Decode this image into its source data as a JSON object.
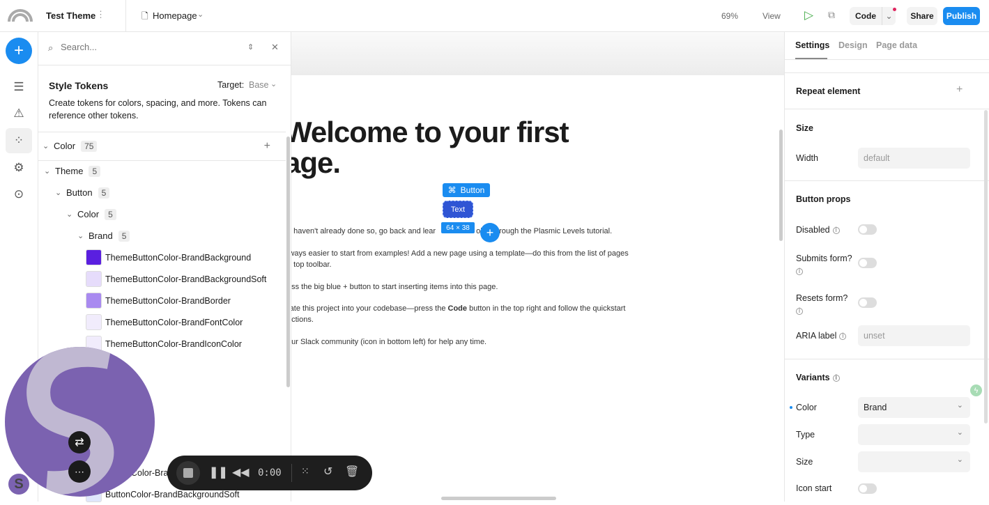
{
  "topbar": {
    "project": "Test Theme",
    "page": "Homepage",
    "zoom": "69%",
    "view": "View",
    "code": "Code",
    "share": "Share",
    "publish": "Publish"
  },
  "left_panel": {
    "search_placeholder": "Search...",
    "title": "Style Tokens",
    "target_label": "Target:",
    "target_value": "Base",
    "description": "Create tokens for colors, spacing, and more. Tokens can reference other tokens.",
    "groups": [
      {
        "label": "Color",
        "count": "75"
      },
      {
        "label": "Theme",
        "count": "5"
      },
      {
        "label": "Button",
        "count": "5"
      },
      {
        "label": "Color",
        "count": "5"
      },
      {
        "label": "Brand",
        "count": "5"
      }
    ],
    "tokens": [
      {
        "name": "ThemeButtonColor-BrandBackground",
        "color": "#5a1fe0"
      },
      {
        "name": "ThemeButtonColor-BrandBackgroundSoft",
        "color": "#e6dcfb"
      },
      {
        "name": "ThemeButtonColor-BrandBorder",
        "color": "#a98af0"
      },
      {
        "name": "ThemeButtonColor-BrandFontColor",
        "color": "#f1ecfc"
      },
      {
        "name": "ThemeButtonColor-BrandIconColor",
        "color": "#f1ecfc"
      }
    ],
    "bottom_tokens": [
      "Color-Bra",
      "ButtonColor-BrandBackgroundSoft"
    ]
  },
  "canvas": {
    "heading1": "Welcome to your first",
    "heading2": "age.",
    "selection_label": "Button",
    "button_text": "Text",
    "size_readout": "64 × 38",
    "paragraphs": [
      "u haven't already done so, go back and lear",
      "oing through the Plasmic Levels tutorial.",
      "lways easier to start from examples! Add a new page using a template—do this from the list of pages",
      "e top toolbar.",
      "ess the big blue + button to start inserting items into this page.",
      "rate this project into your codebase—press the ",
      "Code",
      " button in the top right and follow the quickstart",
      "uctions.",
      "our Slack community (icon in bottom left) for help any time."
    ]
  },
  "recorder": {
    "time": "0:00"
  },
  "right_panel": {
    "tabs": [
      "Settings",
      "Design",
      "Page data"
    ],
    "repeat": "Repeat element",
    "size": "Size",
    "width_label": "Width",
    "width_value": "default",
    "button_props": "Button props",
    "disabled": "Disabled",
    "submits": "Submits form?",
    "resets": "Resets form?",
    "aria_label": "ARIA label",
    "aria_value": "unset",
    "variants": "Variants",
    "color_label": "Color",
    "color_value": "Brand",
    "type_label": "Type",
    "size_label": "Size",
    "icon_start": "Icon start"
  },
  "colors": {
    "accent": "#1a8cf0",
    "selection": "#2f6fe0",
    "avatar": "#7b62b0"
  }
}
